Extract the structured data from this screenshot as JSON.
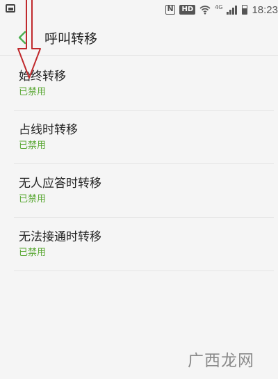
{
  "status_bar": {
    "hd_label": "HD",
    "network_label": "4G",
    "time": "18:23"
  },
  "header": {
    "title": "呼叫转移",
    "back_icon": "chevron-left-icon",
    "accent_color": "#4caf50"
  },
  "forwarding_options": [
    {
      "title": "始终转移",
      "status": "已禁用"
    },
    {
      "title": "占线时转移",
      "status": "已禁用"
    },
    {
      "title": "无人应答时转移",
      "status": "已禁用"
    },
    {
      "title": "无法接通时转移",
      "status": "已禁用"
    }
  ],
  "status_color": "#5aa834",
  "annotation_color": "#c0292c",
  "watermark": "广西龙网"
}
